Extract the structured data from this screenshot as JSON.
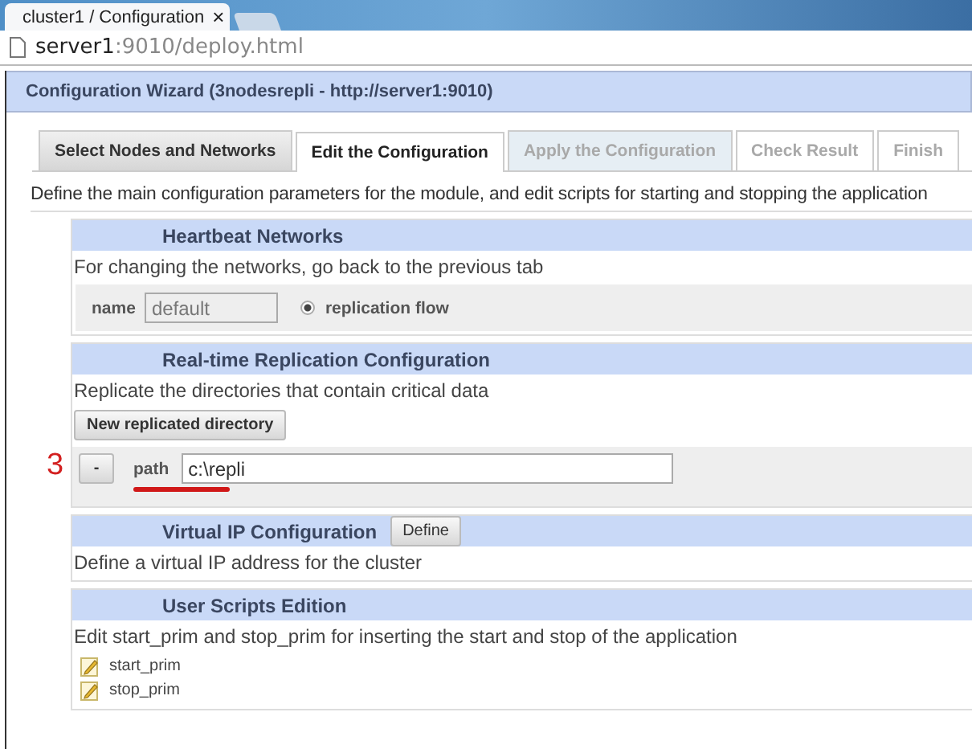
{
  "browser": {
    "tab_title": "cluster1 / Configuration",
    "tab_close": "×",
    "url_host": "server1",
    "url_rest": ":9010/deploy.html"
  },
  "wizard": {
    "title": "Configuration Wizard (3nodesrepli - http://server1:9010)"
  },
  "tabs": [
    {
      "label": "Select Nodes and Networks",
      "selected": false,
      "disabled": false
    },
    {
      "label": "Edit the Configuration",
      "selected": true,
      "disabled": false
    },
    {
      "label": "Apply the Configuration",
      "selected": false,
      "disabled": true
    },
    {
      "label": "Check Result",
      "selected": false,
      "disabled": true
    },
    {
      "label": "Finish",
      "selected": false,
      "disabled": true
    }
  ],
  "intro": "Define the main configuration parameters for the module, and edit scripts for starting and stopping the application",
  "heartbeat": {
    "title": "Heartbeat Networks",
    "note": "For changing the networks, go back to the previous tab",
    "name_label": "name",
    "name_value": "default",
    "radio_label": "replication flow",
    "radio_checked": true
  },
  "replication": {
    "title": "Real-time Replication Configuration",
    "note": "Replicate the directories that contain critical data",
    "new_button": "New replicated directory",
    "remove_button": "-",
    "path_label": "path",
    "path_value": "c:\\repli",
    "annotation": "3"
  },
  "virtual_ip": {
    "title": "Virtual IP Configuration",
    "define_button": "Define",
    "note": "Define a virtual IP address for the cluster"
  },
  "scripts": {
    "title": "User Scripts Edition",
    "note": "Edit start_prim and stop_prim for inserting the start and stop of the application",
    "files": [
      "start_prim",
      "stop_prim"
    ]
  }
}
